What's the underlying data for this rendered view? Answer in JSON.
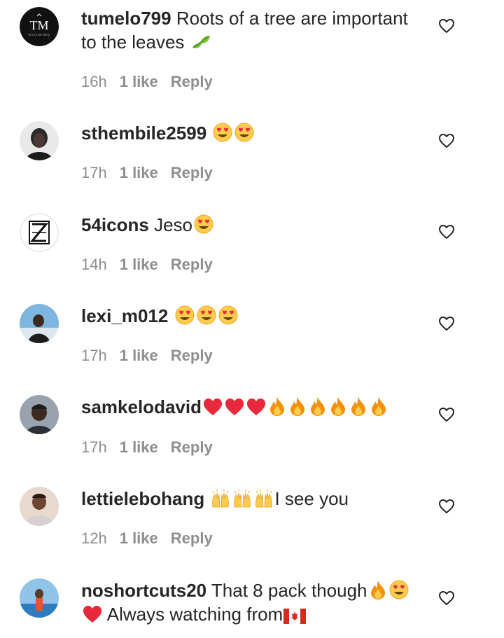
{
  "comments": [
    {
      "username": "tumelo799",
      "text": "Roots of a tree are important to the leaves",
      "emojis": [
        "leaf"
      ],
      "time": "16h",
      "likes": "1 like",
      "reply": "Reply",
      "avatar": {
        "type": "logo",
        "logo_text": "TM",
        "sub_text": "VESTLE BE GREAT"
      }
    },
    {
      "username": "sthembile2599",
      "text": "",
      "emojis": [
        "heart-eyes",
        "heart-eyes"
      ],
      "time": "17h",
      "likes": "1 like",
      "reply": "Reply",
      "avatar": {
        "type": "photo"
      }
    },
    {
      "username": "54icons",
      "text": "Jeso",
      "emojis": [
        "heart-eyes"
      ],
      "time": "14h",
      "likes": "1 like",
      "reply": "Reply",
      "avatar": {
        "type": "logo"
      }
    },
    {
      "username": "lexi_m012",
      "text": "",
      "emojis": [
        "heart-eyes",
        "heart-eyes",
        "heart-eyes"
      ],
      "time": "17h",
      "likes": "1 like",
      "reply": "Reply",
      "avatar": {
        "type": "photo"
      }
    },
    {
      "username": "samkelodavid",
      "text": "",
      "emojis": [
        "red-heart",
        "red-heart",
        "red-heart",
        "fire",
        "fire",
        "fire",
        "fire",
        "fire",
        "fire"
      ],
      "time": "17h",
      "likes": "1 like",
      "reply": "Reply",
      "avatar": {
        "type": "photo"
      }
    },
    {
      "username": "lettielebohang",
      "text": "I see you",
      "emojis_before_text": [
        "raising-hands",
        "raising-hands",
        "raising-hands"
      ],
      "time": "12h",
      "likes": "1 like",
      "reply": "Reply",
      "avatar": {
        "type": "photo"
      }
    },
    {
      "username": "noshortcuts20",
      "text": "That 8 pack though",
      "emojis": [
        "fire",
        "heart-eyes"
      ],
      "text_line2": "Always watching from",
      "emojis_line2_before": [
        "red-heart"
      ],
      "emojis_line2_after": [
        "flag-canada"
      ],
      "avatar": {
        "type": "photo"
      }
    }
  ],
  "icons": {
    "like": "heart-outline-icon"
  },
  "colors": {
    "text": "#262626",
    "meta": "#8e8e8e",
    "background": "#ffffff"
  }
}
